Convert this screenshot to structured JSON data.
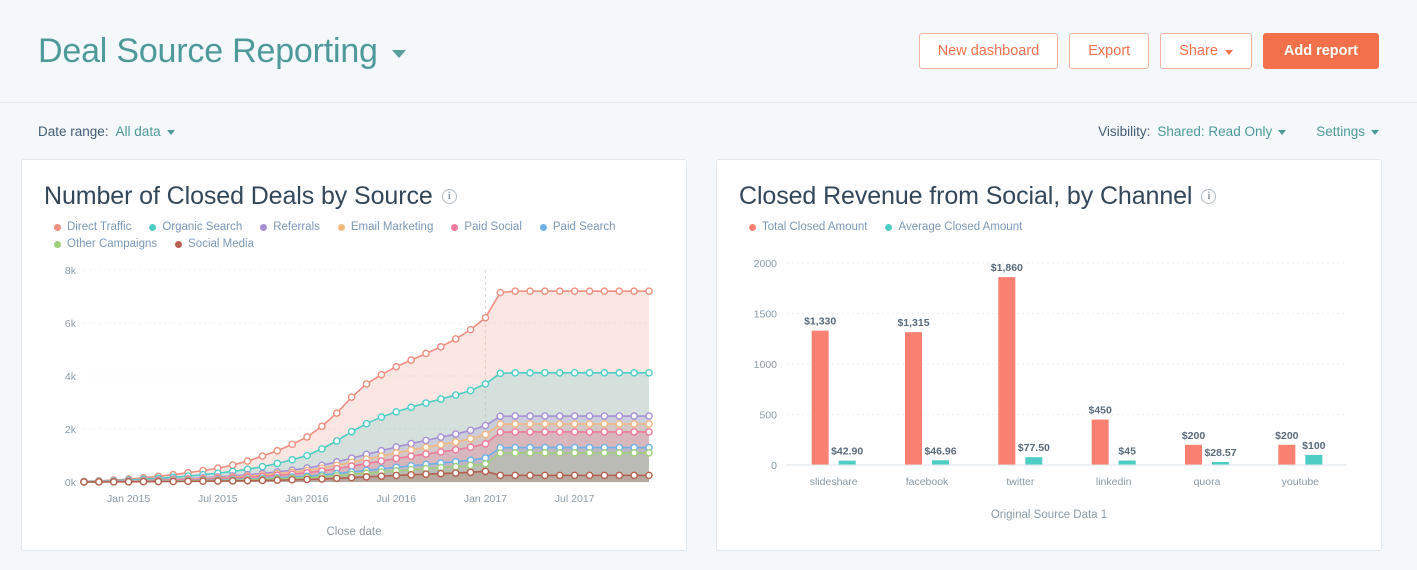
{
  "header": {
    "title": "Deal Source Reporting",
    "dropdown_icon": "chevron-down-icon",
    "buttons": [
      {
        "label": "New dashboard",
        "style": "outline",
        "caret": false
      },
      {
        "label": "Export",
        "style": "outline",
        "caret": false
      },
      {
        "label": "Share",
        "style": "outline",
        "caret": true
      },
      {
        "label": "Add report",
        "style": "primary",
        "caret": false
      }
    ]
  },
  "subbar": {
    "date_range_label": "Date range:",
    "date_range_value": "All data",
    "visibility_label": "Visibility:",
    "visibility_value": "Shared: Read Only",
    "settings_label": "Settings"
  },
  "colors": {
    "accent_orange": "#f2714b",
    "teal": "#4e9a9b",
    "background": "#f5f8fa",
    "card": "#ffffff",
    "bar_total": "#fa8072",
    "bar_average": "#4ecdc4"
  },
  "cards": [
    {
      "title": "Number of Closed Deals by Source",
      "info_icon": "info-icon"
    },
    {
      "title": "Closed Revenue from Social, by Channel",
      "info_icon": "info-icon"
    }
  ],
  "chart_data": [
    {
      "type": "area",
      "title": "Number of Closed Deals by Source",
      "xlabel": "Close date",
      "ylabel": "",
      "ylim": [
        0,
        8000
      ],
      "ytick_labels": [
        "0k",
        "2k",
        "4k",
        "6k",
        "8k"
      ],
      "ytick_values": [
        0,
        2000,
        4000,
        6000,
        8000
      ],
      "xtick_labels": [
        "Jan 2015",
        "Jul 2015",
        "Jan 2016",
        "Jul 2016",
        "Jan 2017",
        "Jul 2017"
      ],
      "grid": true,
      "legend_position": "top",
      "stacked": false,
      "x": [
        "Oct 2014",
        "Nov 2014",
        "Dec 2014",
        "Jan 2015",
        "Feb 2015",
        "Mar 2015",
        "Apr 2015",
        "May 2015",
        "Jun 2015",
        "Jul 2015",
        "Aug 2015",
        "Sep 2015",
        "Oct 2015",
        "Nov 2015",
        "Dec 2015",
        "Jan 2016",
        "Feb 2016",
        "Mar 2016",
        "Apr 2016",
        "May 2016",
        "Jun 2016",
        "Jul 2016",
        "Aug 2016",
        "Sep 2016",
        "Oct 2016",
        "Nov 2016",
        "Dec 2016",
        "Jan 2017",
        "Feb 2017",
        "Mar 2017",
        "Apr 2017",
        "May 2017",
        "Jun 2017",
        "Jul 2017",
        "Aug 2017",
        "Sep 2017",
        "Oct 2017",
        "Nov 2017",
        "Dec 2017"
      ],
      "series": [
        {
          "name": "Direct Traffic",
          "color": "#ef8e80",
          "values": [
            20,
            45,
            75,
            110,
            160,
            215,
            275,
            350,
            430,
            520,
            640,
            790,
            980,
            1180,
            1420,
            1700,
            2100,
            2600,
            3200,
            3700,
            4050,
            4350,
            4600,
            4850,
            5100,
            5400,
            5750,
            6200,
            7150,
            7200,
            7200,
            7200,
            7200,
            7200,
            7200,
            7200,
            7200,
            7200,
            7200
          ]
        },
        {
          "name": "Organic Search",
          "color": "#4ecdc4",
          "values": [
            15,
            30,
            50,
            75,
            105,
            140,
            180,
            225,
            275,
            330,
            400,
            480,
            580,
            700,
            840,
            1000,
            1250,
            1550,
            1900,
            2200,
            2450,
            2650,
            2820,
            2980,
            3130,
            3280,
            3450,
            3700,
            4100,
            4120,
            4120,
            4120,
            4120,
            4120,
            4120,
            4120,
            4120,
            4120,
            4120
          ]
        },
        {
          "name": "Referrals",
          "color": "#a78fd6",
          "values": [
            8,
            18,
            30,
            45,
            62,
            82,
            105,
            130,
            158,
            190,
            228,
            272,
            322,
            380,
            448,
            525,
            630,
            760,
            900,
            1040,
            1180,
            1320,
            1450,
            1570,
            1690,
            1810,
            1950,
            2130,
            2480,
            2490,
            2490,
            2490,
            2490,
            2490,
            2490,
            2490,
            2490,
            2490,
            2490
          ]
        },
        {
          "name": "Email Marketing",
          "color": "#f2b880",
          "values": [
            6,
            14,
            24,
            36,
            50,
            66,
            85,
            106,
            130,
            156,
            187,
            223,
            264,
            312,
            368,
            432,
            520,
            628,
            745,
            862,
            980,
            1100,
            1210,
            1310,
            1410,
            1510,
            1630,
            1790,
            2180,
            2190,
            2190,
            2190,
            2190,
            2190,
            2190,
            2190,
            2190,
            2190,
            2190
          ]
        },
        {
          "name": "Paid Social",
          "color": "#ef7a9b",
          "values": [
            5,
            11,
            19,
            29,
            40,
            53,
            68,
            85,
            104,
            125,
            150,
            179,
            212,
            250,
            295,
            347,
            418,
            505,
            600,
            695,
            790,
            886,
            975,
            1055,
            1135,
            1215,
            1312,
            1440,
            1880,
            1890,
            1890,
            1890,
            1890,
            1890,
            1890,
            1890,
            1890,
            1890,
            1890
          ]
        },
        {
          "name": "Paid Search",
          "color": "#6cb2e8",
          "values": [
            3,
            7,
            12,
            18,
            25,
            33,
            42,
            53,
            65,
            78,
            94,
            112,
            133,
            157,
            185,
            218,
            262,
            317,
            377,
            437,
            497,
            557,
            613,
            664,
            714,
            765,
            826,
            907,
            1290,
            1300,
            1300,
            1300,
            1300,
            1300,
            1300,
            1300,
            1300,
            1300,
            1300
          ]
        },
        {
          "name": "Other Campaigns",
          "color": "#9ed07c",
          "values": [
            2,
            5,
            9,
            14,
            19,
            25,
            32,
            40,
            49,
            59,
            71,
            85,
            101,
            119,
            140,
            165,
            198,
            240,
            285,
            331,
            376,
            421,
            464,
            502,
            540,
            578,
            624,
            686,
            1090,
            1100,
            1100,
            1100,
            1100,
            1100,
            1100,
            1100,
            1100,
            1100,
            1100
          ]
        },
        {
          "name": "Social Media",
          "color": "#b5604f",
          "values": [
            1,
            3,
            5,
            8,
            11,
            15,
            19,
            24,
            29,
            35,
            42,
            50,
            59,
            70,
            82,
            97,
            116,
            141,
            167,
            194,
            221,
            247,
            272,
            295,
            317,
            339,
            366,
            402,
            248,
            250,
            250,
            250,
            250,
            250,
            250,
            250,
            250,
            250,
            250
          ]
        }
      ]
    },
    {
      "type": "bar",
      "title": "Closed Revenue from Social, by Channel",
      "xlabel": "Original Source Data 1",
      "ylabel": "",
      "ylim": [
        0,
        2000
      ],
      "ytick_labels": [
        "0",
        "500",
        "1000",
        "1500",
        "2000"
      ],
      "ytick_values": [
        0,
        500,
        1000,
        1500,
        2000
      ],
      "grid": true,
      "legend_position": "top",
      "categories": [
        "slideshare",
        "facebook",
        "twitter",
        "linkedin",
        "quora",
        "youtube"
      ],
      "series": [
        {
          "name": "Total Closed Amount",
          "color": "#fa8072",
          "values": [
            1330,
            1315,
            1860,
            450,
            200,
            200
          ],
          "labels": [
            "$1,330",
            "$1,315",
            "$1,860",
            "$450",
            "$200",
            "$200"
          ]
        },
        {
          "name": "Average Closed Amount",
          "color": "#4ecdc4",
          "values": [
            42.9,
            46.96,
            77.5,
            45,
            28.57,
            100
          ],
          "labels": [
            "$42.90",
            "$46.96",
            "$77.50",
            "$45",
            "$28.57",
            "$100"
          ]
        }
      ]
    }
  ]
}
